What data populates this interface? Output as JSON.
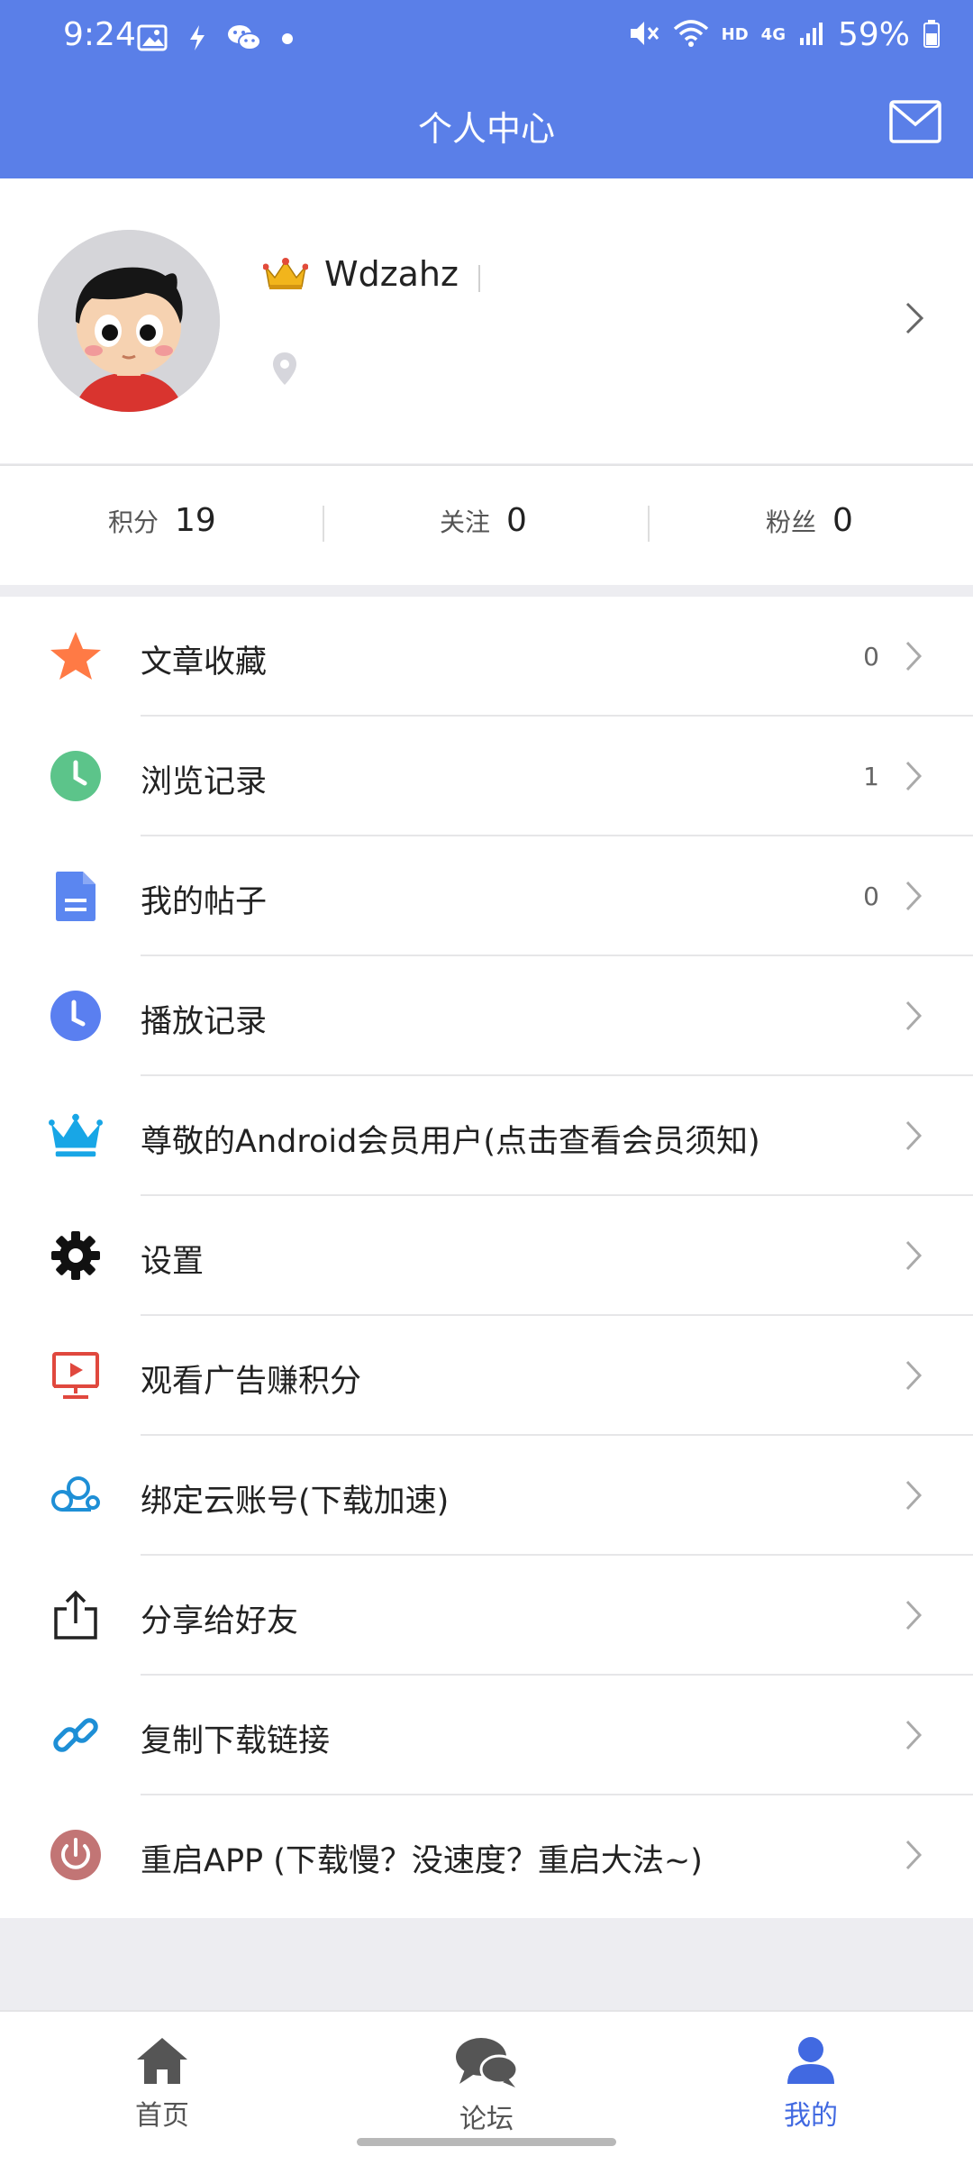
{
  "status": {
    "time": "9:24",
    "network": "HD",
    "lte": "4G",
    "battery": "59%"
  },
  "header": {
    "title": "个人中心"
  },
  "profile": {
    "username": "Wdzahz"
  },
  "stats": [
    {
      "label": "积分",
      "value": "19"
    },
    {
      "label": "关注",
      "value": "0"
    },
    {
      "label": "粉丝",
      "value": "0"
    }
  ],
  "menu": [
    {
      "label": "文章收藏",
      "count": "0",
      "icon": "star-icon"
    },
    {
      "label": "浏览记录",
      "count": "1",
      "icon": "history-clock-icon"
    },
    {
      "label": "我的帖子",
      "count": "0",
      "icon": "document-icon"
    },
    {
      "label": "播放记录",
      "count": "",
      "icon": "play-history-clock-icon"
    },
    {
      "label": "尊敬的Android会员用户(点击查看会员须知)",
      "count": "",
      "icon": "crown-icon"
    },
    {
      "label": "设置",
      "count": "",
      "icon": "gear-icon"
    },
    {
      "label": "观看广告赚积分",
      "count": "",
      "icon": "video-ad-icon"
    },
    {
      "label": "绑定云账号(下载加速)",
      "count": "",
      "icon": "cloud-link-icon"
    },
    {
      "label": "分享给好友",
      "count": "",
      "icon": "share-icon"
    },
    {
      "label": "复制下载链接",
      "count": "",
      "icon": "link-icon"
    },
    {
      "label": "重启APP  (下载慢？没速度？重启大法~)",
      "count": "",
      "icon": "power-icon"
    }
  ],
  "tabs": [
    {
      "label": "首页",
      "icon": "home-icon"
    },
    {
      "label": "论坛",
      "icon": "forum-chat-icon"
    },
    {
      "label": "我的",
      "icon": "user-icon"
    }
  ],
  "colors": {
    "primary": "#5a7fe8",
    "active_tab": "#4169e1",
    "star": "#ff7a45",
    "history": "#5cc48a",
    "document": "#5b86f0",
    "play_history": "#5a7ff0",
    "crown": "#18a6e6",
    "ad": "#e0483e",
    "cloud": "#1e8fd6",
    "power": "#c27575"
  }
}
